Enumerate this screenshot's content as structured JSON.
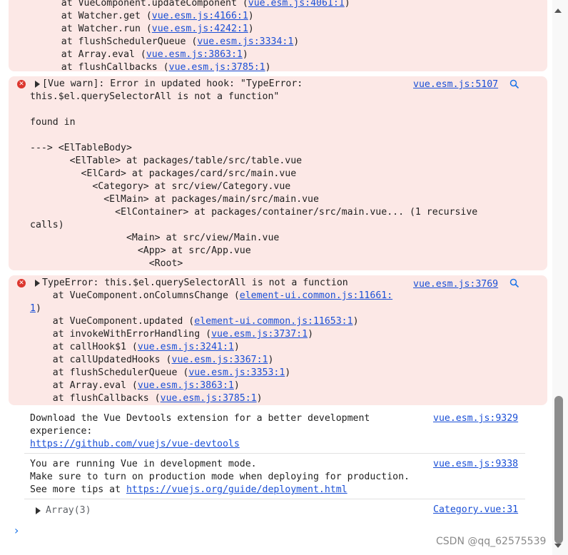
{
  "block1": {
    "lines": [
      {
        "pre": "    at VueComponent.updateComponent (",
        "link": "vue.esm.js:4061:1",
        "post": ")"
      },
      {
        "pre": "    at Watcher.get (",
        "link": "vue.esm.js:4166:1",
        "post": ")"
      },
      {
        "pre": "    at Watcher.run (",
        "link": "vue.esm.js:4242:1",
        "post": ")"
      },
      {
        "pre": "    at flushSchedulerQueue (",
        "link": "vue.esm.js:3334:1",
        "post": ")"
      },
      {
        "pre": "    at Array.eval (",
        "link": "vue.esm.js:3863:1",
        "post": ")"
      },
      {
        "pre": "    at flushCallbacks (",
        "link": "vue.esm.js:3785:1",
        "post": ")"
      }
    ]
  },
  "block2": {
    "source": "vue.esm.js:5107",
    "lines": [
      "[Vue warn]: Error in updated hook: \"TypeError:",
      "this.$el.querySelectorAll is not a function\"",
      "",
      "found in",
      "",
      "---> <ElTableBody>",
      "       <ElTable> at packages/table/src/table.vue",
      "         <ElCard> at packages/card/src/main.vue",
      "           <Category> at src/view/Category.vue",
      "             <ElMain> at packages/main/src/main.vue",
      "               <ElContainer> at packages/container/src/main.vue... (1 recursive",
      "calls)",
      "                 <Main> at src/view/Main.vue",
      "                   <App> at src/App.vue",
      "                     <Root>"
    ]
  },
  "block3": {
    "source": "vue.esm.js:3769",
    "head": "TypeError: this.$el.querySelectorAll is not a function",
    "lines": [
      {
        "pre": "    at VueComponent.onColumnsChange (",
        "link": "element-ui.common.js:11661:",
        "post": ""
      },
      {
        "pre": "",
        "link": "1",
        "post": ")"
      },
      {
        "pre": "    at VueComponent.updated (",
        "link": "element-ui.common.js:11653:1",
        "post": ")"
      },
      {
        "pre": "    at invokeWithErrorHandling (",
        "link": "vue.esm.js:3737:1",
        "post": ")"
      },
      {
        "pre": "    at callHook$1 (",
        "link": "vue.esm.js:3241:1",
        "post": ")"
      },
      {
        "pre": "    at callUpdatedHooks (",
        "link": "vue.esm.js:3367:1",
        "post": ")"
      },
      {
        "pre": "    at flushSchedulerQueue (",
        "link": "vue.esm.js:3353:1",
        "post": ")"
      },
      {
        "pre": "    at Array.eval (",
        "link": "vue.esm.js:3863:1",
        "post": ")"
      },
      {
        "pre": "    at flushCallbacks (",
        "link": "vue.esm.js:3785:1",
        "post": ")"
      }
    ]
  },
  "msg1": {
    "source": "vue.esm.js:9329",
    "line1": "Download the Vue Devtools extension for a better development",
    "line2": "experience:",
    "link": "https://github.com/vuejs/vue-devtools"
  },
  "msg2": {
    "source": "vue.esm.js:9338",
    "line1": "You are running Vue in development mode.",
    "line2": "Make sure to turn on production mode when deploying for production.",
    "line3_pre": "See more tips at ",
    "link": "https://vuejs.org/guide/deployment.html"
  },
  "msg3": {
    "source": "Category.vue:31",
    "label": "Array(3)"
  },
  "prompt_symbol": "›",
  "watermark": "CSDN @qq_62575539",
  "icons": {
    "error": "error-circle-icon",
    "expand": "expand-triangle-icon",
    "search": "magnifier-icon"
  },
  "colors": {
    "error_bg": "#fce8e6",
    "error_icon": "#dc362e",
    "link": "#1a4fd6",
    "prompt": "#1a73e8"
  }
}
